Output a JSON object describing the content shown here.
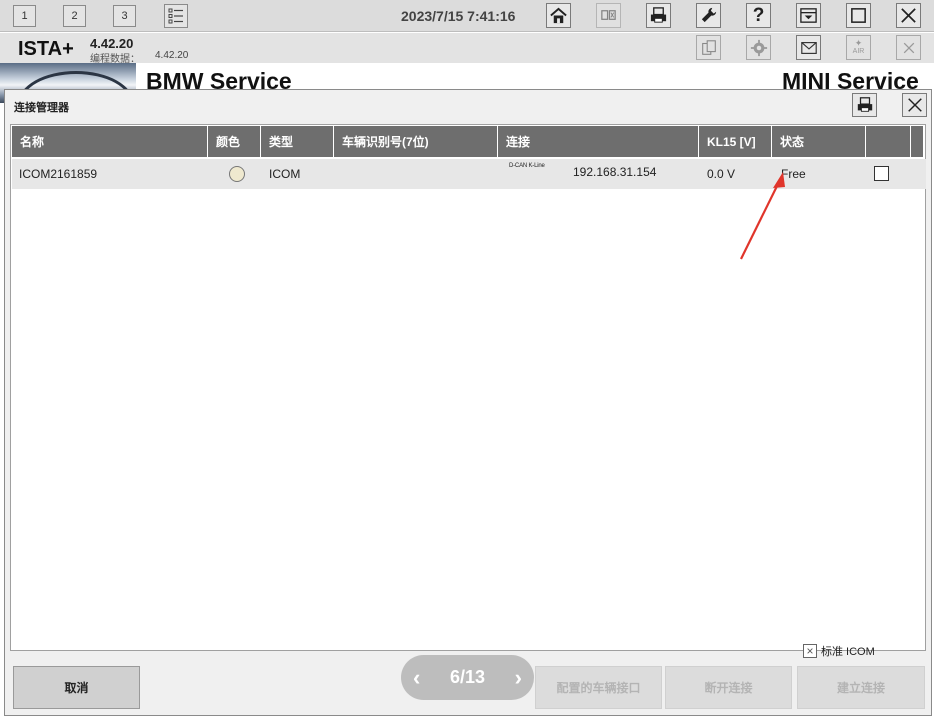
{
  "toolbar": {
    "num_buttons": [
      "1",
      "2",
      "3"
    ],
    "datetime": "2023/7/15 7:41:16",
    "icons": [
      "home-icon",
      "compare-icon",
      "print-icon",
      "wrench-icon",
      "help-icon",
      "dropdown-icon",
      "window-icon",
      "close-icon"
    ]
  },
  "header": {
    "app_name": "ISTA+",
    "version": "4.42.20",
    "data_label": "编程数据：",
    "data_version": "4.42.20",
    "icons": [
      "copy-icon",
      "gear-icon",
      "mail-icon",
      "air-icon",
      "close-icon"
    ],
    "air_label": "AIR"
  },
  "background": {
    "bmw_service": "BMW Service",
    "mini_service": "MINI Service"
  },
  "dialog": {
    "title": "连接管理器",
    "columns": [
      "名称",
      "颜色",
      "类型",
      "车辆识别号(7位)",
      "连接",
      "KL15 [V]",
      "状态",
      ""
    ],
    "rows": [
      {
        "name": "ICOM2161859",
        "type": "ICOM",
        "vin": "",
        "connection_small": "D-CAN K-Line",
        "ip": "192.168.31.154",
        "kl15": "0.0 V",
        "status": "Free",
        "checked": false
      }
    ],
    "standard_icom_label": "标准 ICOM",
    "standard_icom_checked": true,
    "buttons": {
      "cancel": "取消",
      "configure": "配置的车辆接口",
      "disconnect": "断开连接",
      "connect": "建立连接"
    },
    "pager": {
      "label": "6/13"
    }
  },
  "colors": {
    "header_bg": "#6e6e6e",
    "row_bg": "#e7e7e7",
    "arrow": "#e0352b"
  }
}
